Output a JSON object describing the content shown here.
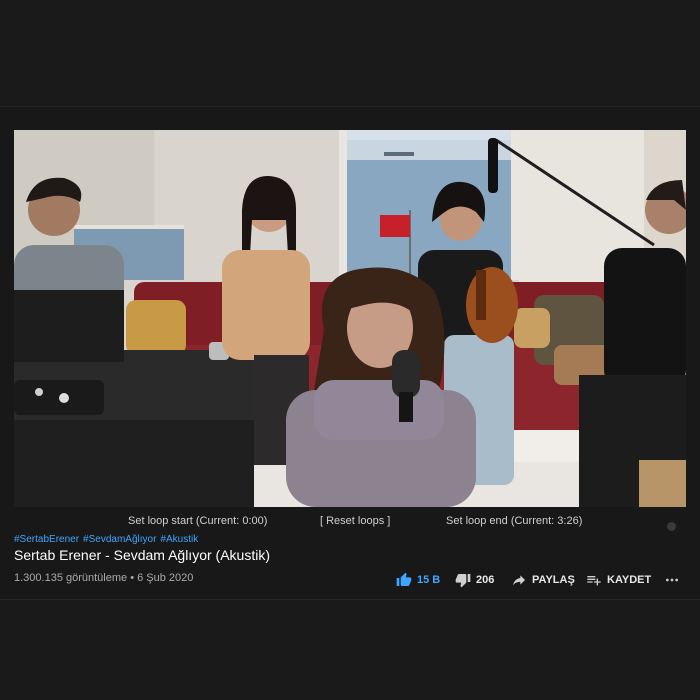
{
  "loop_controls": {
    "set_start": "Set loop start (Current: 0:00)",
    "reset": "[ Reset loops ]",
    "set_end": "Set loop end (Current: 3:26)"
  },
  "video": {
    "hashtags": [
      "#SertabErener",
      "#SevdamAğlıyor",
      "#Akustik"
    ],
    "title": "Sertab Erener - Sevdam Ağlıyor (Akustik)",
    "views": "1.300.135 görüntüleme",
    "date": "6 Şub 2020"
  },
  "actions": {
    "likes": "15 B",
    "dislikes": "206",
    "share": "PAYLAŞ",
    "save": "KAYDET"
  },
  "colors": {
    "like_active": "#3ea6ff",
    "link": "#3ea6ff",
    "background": "#1a1a1a"
  }
}
